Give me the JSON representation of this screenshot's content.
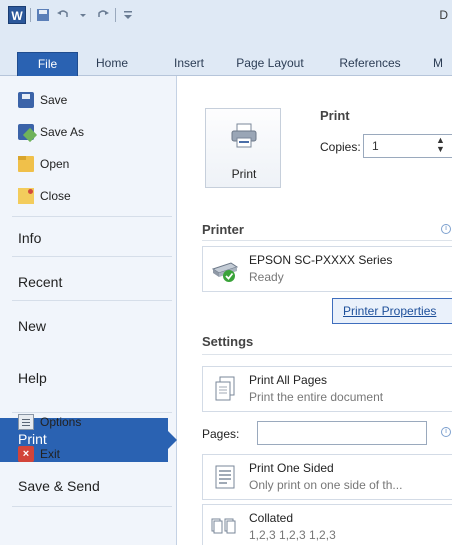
{
  "titlebar": {
    "doc_title": "D",
    "quick_access": [
      "word-icon",
      "save-icon",
      "undo-icon",
      "redo-icon",
      "customize-icon"
    ]
  },
  "tabs": [
    {
      "label": "File"
    },
    {
      "label": "Home"
    },
    {
      "label": "Insert"
    },
    {
      "label": "Page Layout"
    },
    {
      "label": "References"
    },
    {
      "label": "M"
    }
  ],
  "nav": {
    "save": "Save",
    "save_as": "Save As",
    "open": "Open",
    "close": "Close",
    "info": "Info",
    "recent": "Recent",
    "new": "New",
    "print": "Print",
    "save_send": "Save & Send",
    "help": "Help",
    "options": "Options",
    "exit": "Exit"
  },
  "print": {
    "button_label": "Print",
    "heading": "Print",
    "copies_label": "Copies:",
    "copies_value": "1"
  },
  "printer": {
    "heading": "Printer",
    "name": "EPSON SC-PXXXX Series",
    "status": "Ready",
    "properties_link": "Printer Properties"
  },
  "settings": {
    "heading": "Settings",
    "print_all_title": "Print All Pages",
    "print_all_sub": "Print the entire document",
    "pages_label": "Pages:",
    "pages_value": "",
    "one_sided_title": "Print One Sided",
    "one_sided_sub": "Only print on one side of th...",
    "collated_title": "Collated",
    "collated_sub": "1,2,3   1,2,3   1,2,3"
  },
  "colors": {
    "accent": "#2a62b2",
    "ribbon_bg": "#dfe9f5",
    "nav_bg": "#f1f5fb"
  }
}
